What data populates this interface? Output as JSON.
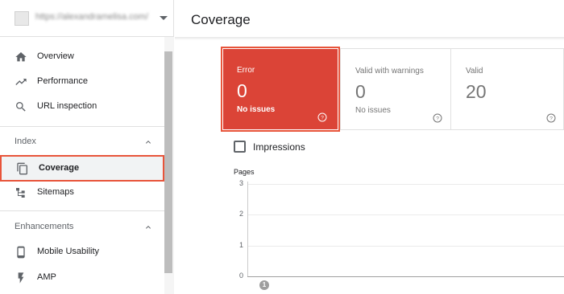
{
  "sidebar": {
    "property_url": "https://alexandramelisa.com/",
    "items_top": [
      {
        "label": "Overview",
        "icon": "home-icon"
      },
      {
        "label": "Performance",
        "icon": "trending-up-icon"
      },
      {
        "label": "URL inspection",
        "icon": "search-icon"
      }
    ],
    "index_section": {
      "title": "Index",
      "items": [
        {
          "label": "Coverage",
          "icon": "copy-pages-icon",
          "active": true
        },
        {
          "label": "Sitemaps",
          "icon": "sitemap-icon"
        }
      ]
    },
    "enhancements_section": {
      "title": "Enhancements",
      "items": [
        {
          "label": "Mobile Usability",
          "icon": "phone-icon"
        },
        {
          "label": "AMP",
          "icon": "bolt-icon"
        }
      ]
    }
  },
  "main": {
    "title": "Coverage",
    "cards": [
      {
        "label": "Error",
        "value": "0",
        "sub": "No issues",
        "color": "#db4437",
        "selected": true
      },
      {
        "label": "Valid with warnings",
        "value": "0",
        "sub": "No issues"
      },
      {
        "label": "Valid",
        "value": "20"
      }
    ],
    "impressions_label": "Impressions",
    "impressions_checked": false
  },
  "chart_data": {
    "type": "line",
    "ylabel": "Pages",
    "yticks": [
      "3",
      "2",
      "1",
      "0"
    ],
    "ylim": [
      0,
      3
    ],
    "grid": true,
    "annotations": [
      "1"
    ],
    "series": []
  },
  "colors": {
    "accent": "#e8543a",
    "error": "#db4437"
  }
}
